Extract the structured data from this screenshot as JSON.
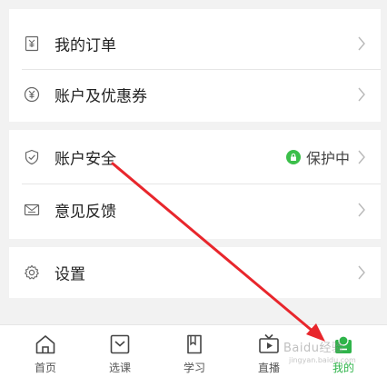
{
  "menu": {
    "orders": {
      "label": "我的订单",
      "icon": "receipt-icon"
    },
    "coupons": {
      "label": "账户及优惠券",
      "icon": "yen-coin-icon"
    },
    "security": {
      "label": "账户安全",
      "icon": "shield-icon",
      "status": "保护中"
    },
    "feedback": {
      "label": "意见反馈",
      "icon": "mail-icon"
    },
    "settings": {
      "label": "设置",
      "icon": "gear-icon"
    }
  },
  "tabbar": {
    "tabs": [
      {
        "label": "首页",
        "icon": "home-icon",
        "active": false
      },
      {
        "label": "选课",
        "icon": "course-icon",
        "active": false
      },
      {
        "label": "学习",
        "icon": "book-icon",
        "active": false
      },
      {
        "label": "直播",
        "icon": "tv-icon",
        "active": false
      },
      {
        "label": "我的",
        "icon": "profile-icon",
        "active": true
      }
    ]
  },
  "watermark": {
    "text": "Baidu经验",
    "sub": "jingyan.baidu.com"
  },
  "colors": {
    "accent": "#2fb44a",
    "annotation_arrow": "#e8262c",
    "background": "#f2f2f2"
  }
}
